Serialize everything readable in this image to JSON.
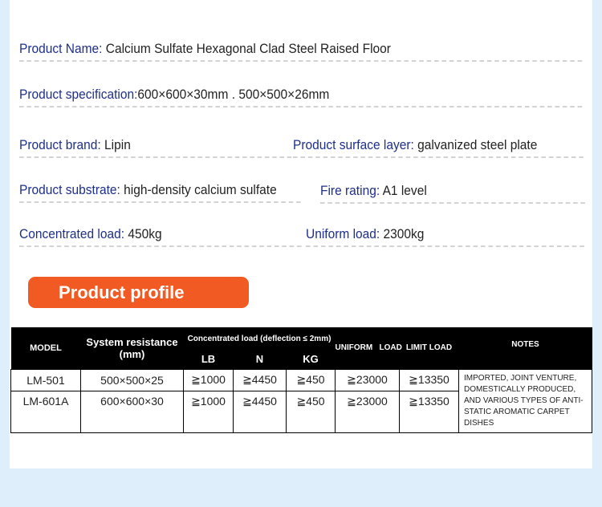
{
  "specs": [
    {
      "key": "Product Name:",
      "value": " Calcium Sulfate Hexagonal Clad Steel Raised Floor"
    },
    {
      "key": "Product specification:",
      "value": "600×600×30mm . 500×500×26mm"
    },
    {
      "key": "Product brand:",
      "value": " Lipin"
    },
    {
      "key": "Product surface layer:",
      "value": " galvanized steel plate"
    },
    {
      "key": "Product substrate:",
      "value": " high-density calcium sulfate"
    },
    {
      "key": "Fire rating:",
      "value": " A1 level"
    },
    {
      "key": "Concentrated load:",
      "value": " 450kg"
    },
    {
      "key": "Uniform load:",
      "value": " 2300kg"
    }
  ],
  "profile_button": {
    "label": "Product profile"
  },
  "table": {
    "headers": {
      "model": "MODEL",
      "system": "System resistance (mm)",
      "concentrated": "Concentrated load (deflection ≤ 2mm)",
      "lb": "LB",
      "n": "N",
      "kg": "KG",
      "uniform": "UNIFORM   LOAD",
      "limit": "LIMIT LOAD",
      "notes": "NOTES"
    },
    "rows": [
      {
        "model": "LM-501",
        "system": "500×500×25",
        "lb": "≧1000",
        "n": "≧4450",
        "kg": "≧450",
        "uniform": "≧23000",
        "limit": "≧13350"
      },
      {
        "model": "LM-601A",
        "system": "600×600×30",
        "lb": "≧1000",
        "n": "≧4450",
        "kg": "≧450",
        "uniform": "≧23000",
        "limit": "≧13350"
      }
    ],
    "notes": "Imported, joint venture, domestically produced, and various types of anti-static aromatic carpet dishes"
  }
}
